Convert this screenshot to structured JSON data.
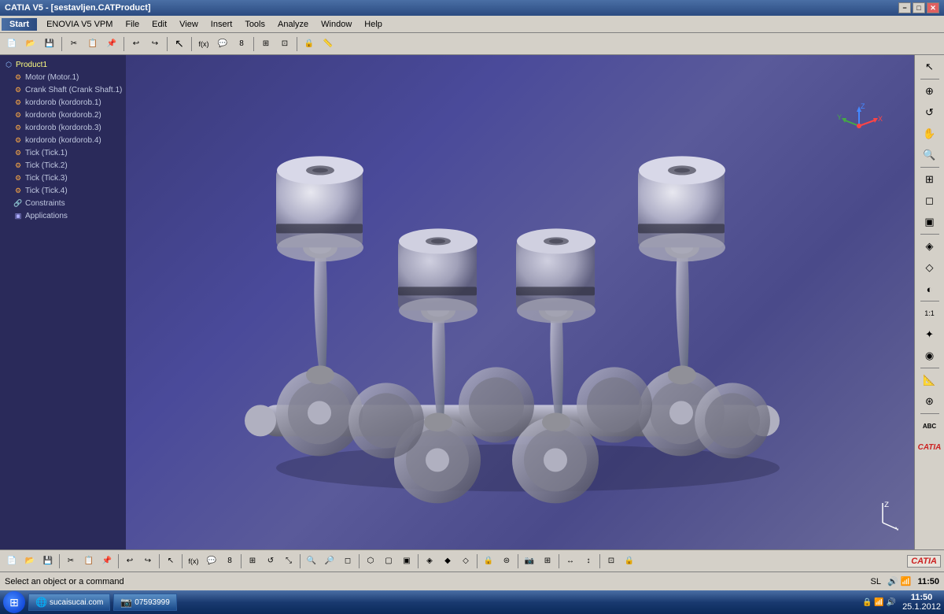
{
  "titlebar": {
    "title": "CATIA V5 - [sestavljen.CATProduct]",
    "min_btn": "−",
    "max_btn": "□",
    "close_btn": "✕"
  },
  "menubar": {
    "items": [
      "Start",
      "ENOVIA V5 VPM",
      "File",
      "Edit",
      "View",
      "Insert",
      "Tools",
      "Analyze",
      "Window",
      "Help"
    ]
  },
  "tree": {
    "items": [
      {
        "label": "Product1",
        "indent": 0,
        "selected": true
      },
      {
        "label": "Motor (Motor.1)",
        "indent": 1
      },
      {
        "label": "Crank Shaft (Crank Shaft.1)",
        "indent": 1
      },
      {
        "label": "kordorob (kordorob.1)",
        "indent": 1
      },
      {
        "label": "kordorob (kordorob.2)",
        "indent": 1
      },
      {
        "label": "kordorob (kordorob.3)",
        "indent": 1
      },
      {
        "label": "kordorob (kordorob.4)",
        "indent": 1
      },
      {
        "label": "Tick (Tick.1)",
        "indent": 1
      },
      {
        "label": "Tick (Tick.2)",
        "indent": 1
      },
      {
        "label": "Tick (Tick.3)",
        "indent": 1
      },
      {
        "label": "Tick (Tick.4)",
        "indent": 1
      },
      {
        "label": "Constraints",
        "indent": 1
      },
      {
        "label": "Applications",
        "indent": 1
      }
    ]
  },
  "statusbar": {
    "message": "Select an object or a command",
    "right_label": "SL"
  },
  "taskbar": {
    "items": [
      {
        "label": "sucaisucai.com",
        "url": "www.sucaisucai.com"
      },
      {
        "label": "07593999"
      }
    ],
    "time": "11:50",
    "date": "25.1.2012"
  },
  "coord_label": "Z\nY",
  "right_toolbar": {
    "icons": [
      "↗",
      "⊕",
      "⊙",
      "✦",
      "◈",
      "⊞",
      "⊡",
      "⬛",
      "▣",
      "◉",
      "⊛",
      "⊠",
      "◆",
      "⊗",
      "★",
      "⊜",
      "⊝",
      "◐",
      "◑",
      "▲",
      "▼",
      "⊂",
      "∘",
      "ABC"
    ]
  }
}
